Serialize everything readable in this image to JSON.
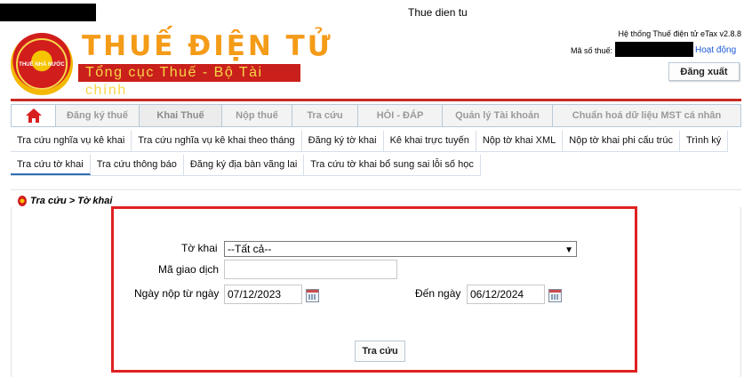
{
  "page_title": "Thue dien tu",
  "brand": {
    "emblem_text": "THUẾ NHÀ NƯỚC",
    "name": "THUẾ ĐIỆN TỬ",
    "subtitle": "Tổng cục Thuế - Bộ Tài chính"
  },
  "account": {
    "system_version": "Hệ thống Thuế điện tử eTax v2.8.8",
    "tax_code_label": "Mã số thuế:",
    "status_link": "Hoạt động",
    "logout_label": "Đăng xuất"
  },
  "main_nav": [
    {
      "label": "Đăng ký thuế"
    },
    {
      "label": "Khai Thuế"
    },
    {
      "label": "Nộp thuế"
    },
    {
      "label": "Tra cứu"
    },
    {
      "label": "HỎI - ĐÁP"
    },
    {
      "label": "Quản lý Tài khoản"
    },
    {
      "label": "Chuẩn hoá dữ liệu MST cá nhân"
    }
  ],
  "sub_nav_1": [
    {
      "label": "Tra cứu nghĩa vụ kê khai"
    },
    {
      "label": "Tra cứu nghĩa vụ kê khai theo tháng"
    },
    {
      "label": "Đăng ký tờ khai"
    },
    {
      "label": "Kê khai trực tuyến"
    },
    {
      "label": "Nộp tờ khai XML"
    },
    {
      "label": "Nộp tờ khai phi cấu trúc"
    },
    {
      "label": "Trình ký"
    }
  ],
  "sub_nav_2": [
    {
      "label": "Tra cứu tờ khai"
    },
    {
      "label": "Tra cứu thông báo"
    },
    {
      "label": "Đăng ký địa bàn vãng lai"
    },
    {
      "label": "Tra cứu tờ khai bổ sung sai lỗi số học"
    }
  ],
  "breadcrumb": "Tra cứu > Tờ khai",
  "form": {
    "declaration_label": "Tờ khai",
    "declaration_value": "--Tất cả--",
    "transaction_label": "Mã giao dịch",
    "transaction_value": "",
    "from_date_label": "Ngày nộp từ ngày",
    "from_date_value": "07/12/2023",
    "to_date_label": "Đến ngày",
    "to_date_value": "06/12/2024",
    "search_label": "Tra cứu"
  },
  "colors": {
    "brand_orange": "#f49b18",
    "brand_red": "#c9201b",
    "highlight_red": "#e02020",
    "link_blue": "#1c5ad4"
  }
}
